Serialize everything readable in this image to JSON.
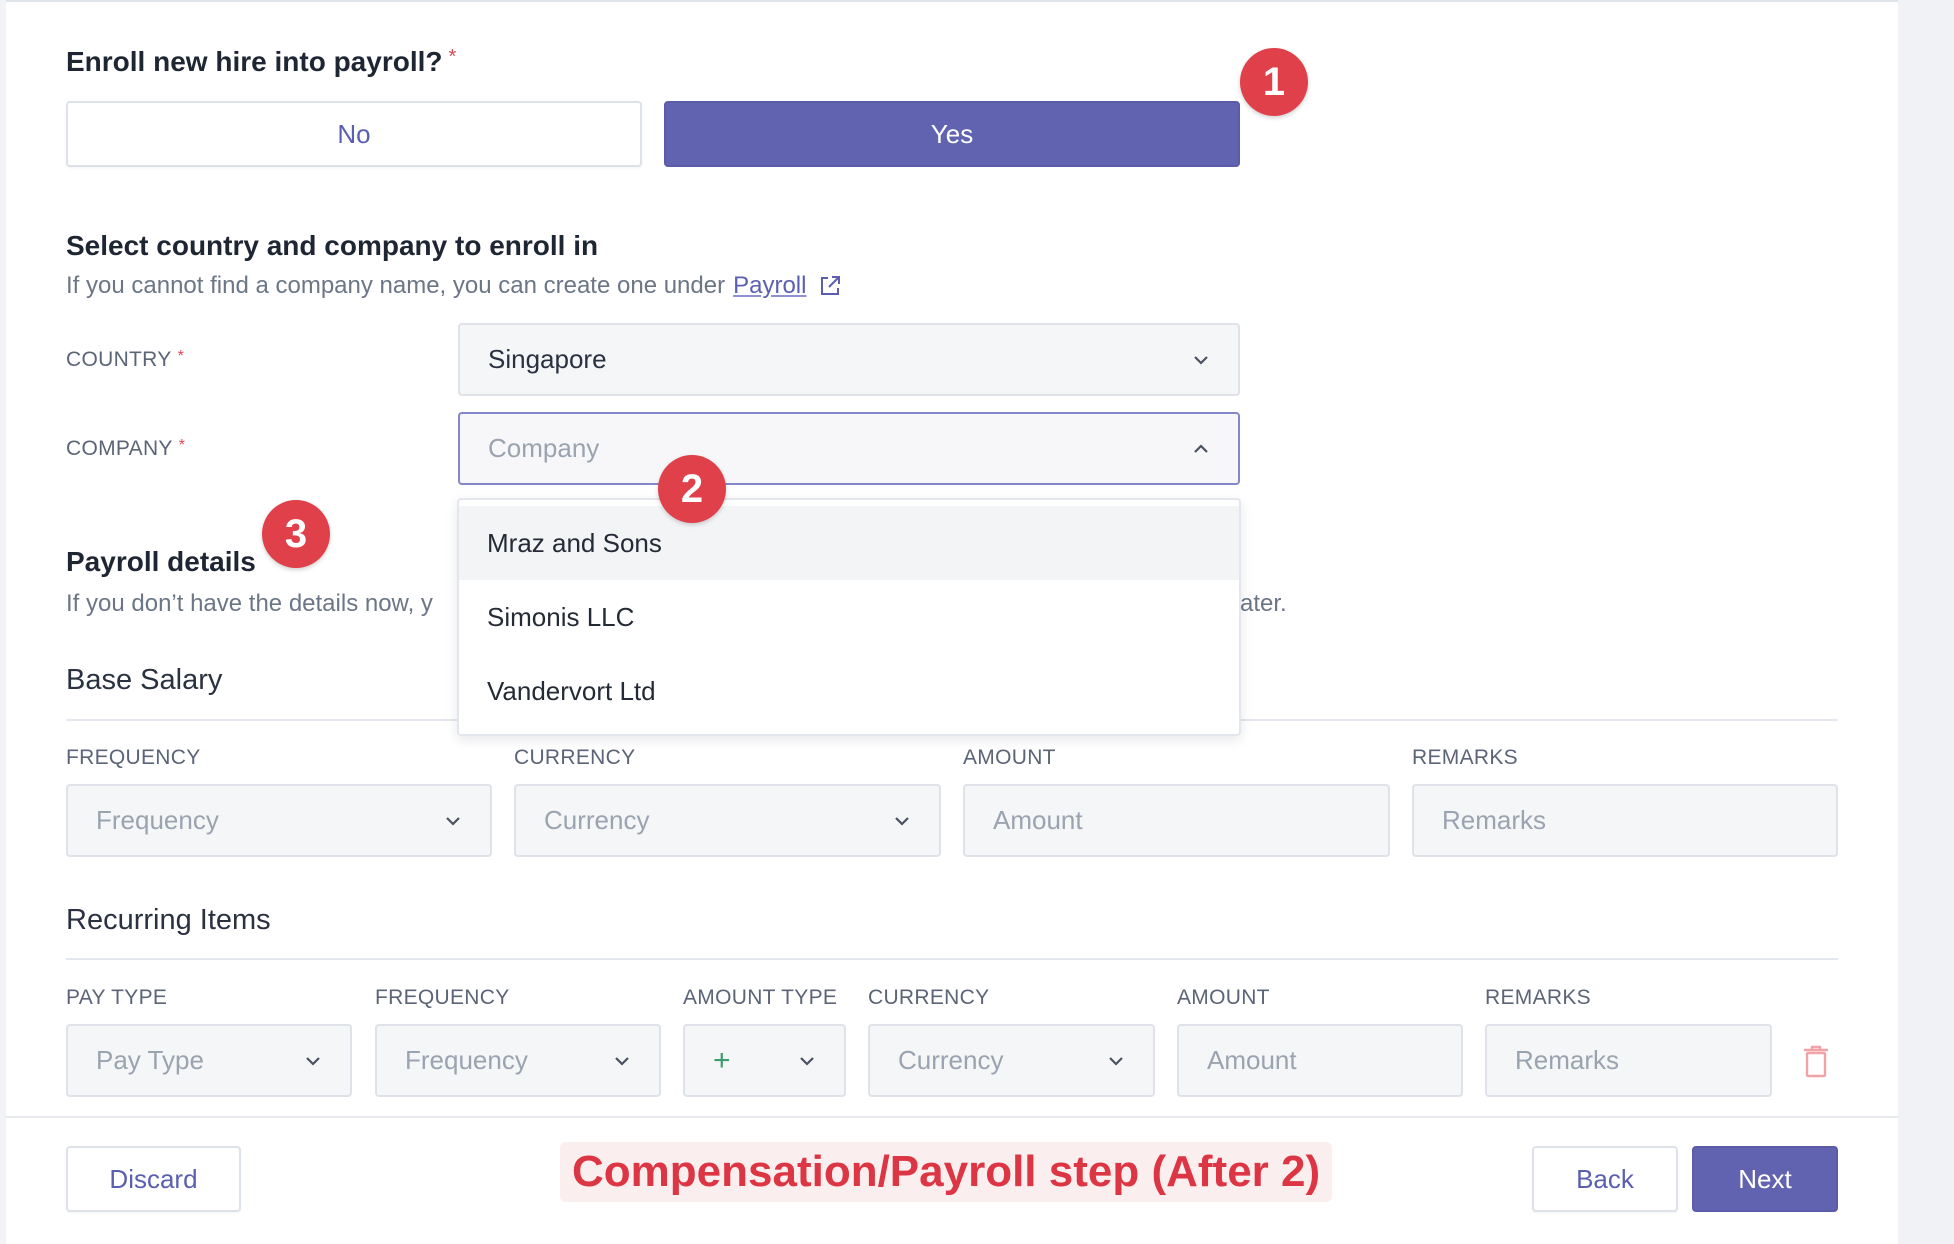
{
  "enroll": {
    "question": "Enroll new hire into payroll?",
    "required_mark": "*",
    "no_label": "No",
    "yes_label": "Yes"
  },
  "select_section": {
    "title": "Select country and company to enroll in",
    "help_prefix": "If you cannot find a company name, you can create one under",
    "help_link": "Payroll",
    "country_label": "COUNTRY",
    "country_value": "Singapore",
    "company_label": "COMPANY",
    "company_placeholder": "Company",
    "company_options": [
      "Mraz and Sons",
      "Simonis LLC",
      "Vandervort Ltd"
    ]
  },
  "payroll_details": {
    "title": "Payroll details",
    "help_left": "If you don’t have the details now, y",
    "help_right": "ater."
  },
  "base_salary": {
    "title": "Base Salary",
    "headers": [
      "FREQUENCY",
      "CURRENCY",
      "AMOUNT",
      "REMARKS"
    ],
    "placeholders": [
      "Frequency",
      "Currency",
      "Amount",
      "Remarks"
    ]
  },
  "recurring_items": {
    "title": "Recurring Items",
    "headers": [
      "PAY TYPE",
      "FREQUENCY",
      "AMOUNT TYPE",
      "CURRENCY",
      "AMOUNT",
      "REMARKS"
    ],
    "placeholders": [
      "Pay Type",
      "Frequency",
      "+",
      "Currency",
      "Amount",
      "Remarks"
    ]
  },
  "footer": {
    "discard_label": "Discard",
    "back_label": "Back",
    "next_label": "Next"
  },
  "annotations": {
    "badge_1": "1",
    "badge_2": "2",
    "badge_3": "3",
    "caption": "Compensation/Payroll step (After 2)"
  },
  "colors": {
    "primary": "#6263b0",
    "annotation_red": "#e0404a",
    "delete_icon": "#f1a3a8"
  }
}
